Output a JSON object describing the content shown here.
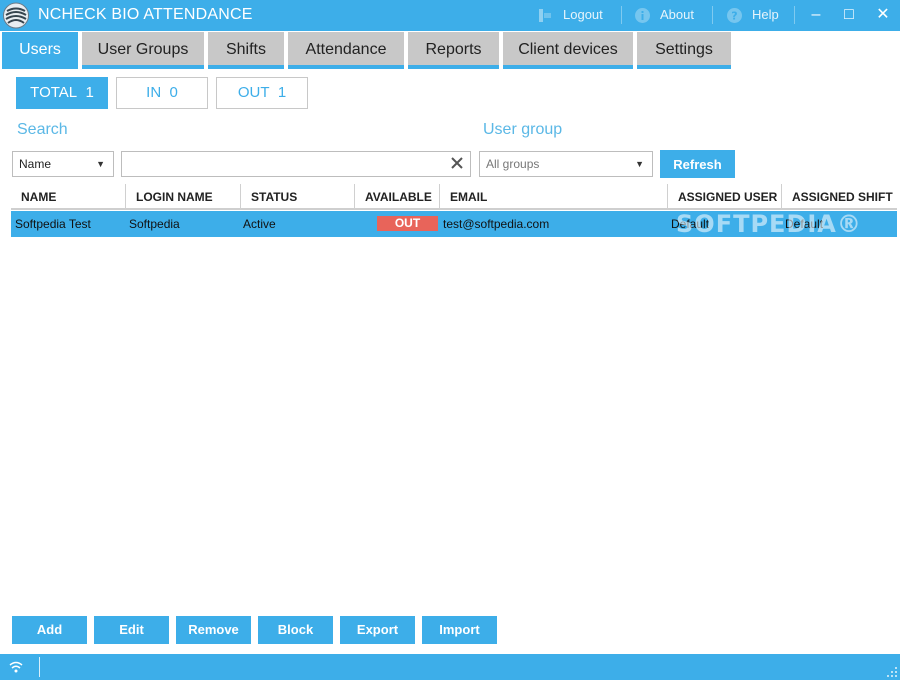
{
  "window": {
    "title": "NCHECK BIO ATTENDANCE",
    "logout_label": "Logout",
    "about_label": "About",
    "help_label": "Help",
    "minimize": "–",
    "maximize": "□",
    "close": "✕"
  },
  "tabs": [
    {
      "label": "Users",
      "active": true
    },
    {
      "label": "User Groups"
    },
    {
      "label": "Shifts"
    },
    {
      "label": "Attendance"
    },
    {
      "label": "Reports"
    },
    {
      "label": "Client devices"
    },
    {
      "label": "Settings"
    }
  ],
  "filters": {
    "total_label": "TOTAL",
    "total_count": "1",
    "in_label": "IN",
    "in_count": "0",
    "out_label": "OUT",
    "out_count": "1"
  },
  "search": {
    "label": "Search",
    "field_select": "Name",
    "value": "",
    "placeholder": ""
  },
  "user_group": {
    "label": "User group",
    "selected": "All groups",
    "refresh_label": "Refresh"
  },
  "table": {
    "columns": [
      "NAME",
      "LOGIN NAME",
      "STATUS",
      "AVAILABLE",
      "EMAIL",
      "ASSIGNED USER",
      "ASSIGNED SHIFT"
    ],
    "rows": [
      {
        "name": "Softpedia Test",
        "login": "Softpedia",
        "status": "Active",
        "available": "OUT",
        "email": "test@softpedia.com",
        "assigned_user": "Default",
        "assigned_shift": "Default"
      }
    ]
  },
  "watermark": "SOFTPEDIA®",
  "actions": [
    "Add",
    "Edit",
    "Remove",
    "Block",
    "Export",
    "Import"
  ],
  "colors": {
    "accent": "#3daee9",
    "out_badge": "#e8645a",
    "tab_inactive": "#c8c8c8"
  }
}
